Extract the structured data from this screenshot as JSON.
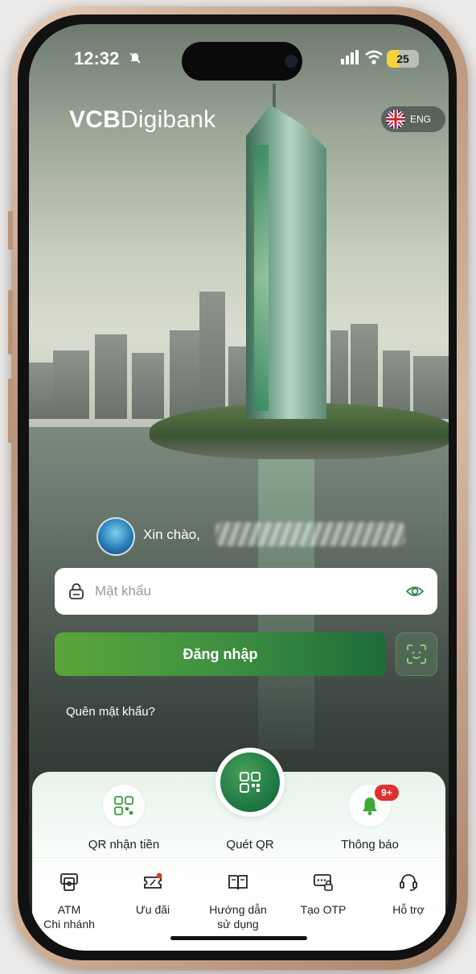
{
  "status_bar": {
    "time": "12:32",
    "battery": "25"
  },
  "header": {
    "logo_bold": "VCB",
    "logo_regular": "Digibank",
    "language": "ENG"
  },
  "greeting": {
    "text": "Xin chào,"
  },
  "login": {
    "password_placeholder": "Mật khẩu",
    "login_label": "Đăng nhập",
    "forgot_label": "Quên mật khẩu?"
  },
  "quick_actions": {
    "qr_receive": "QR nhận tiền",
    "scan_qr": "Quét QR",
    "notifications": "Thông báo",
    "notification_badge": "9+"
  },
  "bottom_nav": [
    {
      "label": "ATM\nChi nhánh",
      "icon": "atm-icon"
    },
    {
      "label": "Ưu đãi",
      "icon": "voucher-icon"
    },
    {
      "label": "Hướng dẫn\nsử dụng",
      "icon": "book-icon"
    },
    {
      "label": "Tạo OTP",
      "icon": "otp-icon"
    },
    {
      "label": "Hỗ trợ",
      "icon": "headset-icon"
    }
  ],
  "colors": {
    "brand_green": "#1e7a44",
    "accent_green": "#5aa53a",
    "badge_red": "#e03030"
  }
}
